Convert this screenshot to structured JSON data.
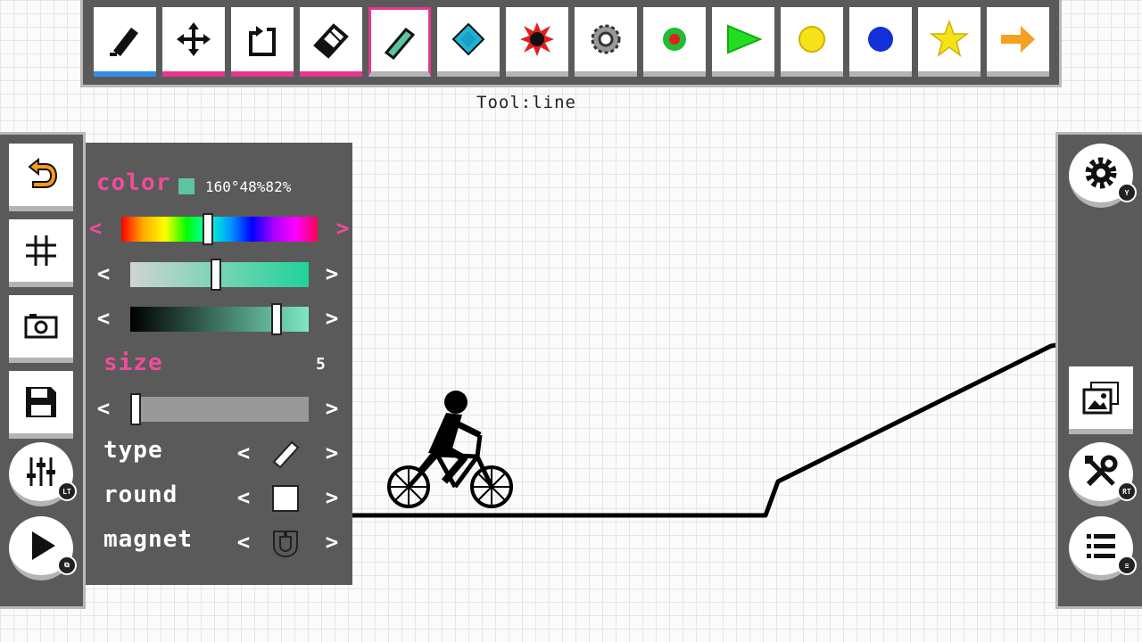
{
  "toolbar": {
    "tools": [
      {
        "id": "pen",
        "icon": "pen-icon"
      },
      {
        "id": "move",
        "icon": "move-arrows-icon"
      },
      {
        "id": "rotate",
        "icon": "rotate-icon"
      },
      {
        "id": "eraser",
        "icon": "eraser-icon"
      },
      {
        "id": "line",
        "icon": "line-icon"
      },
      {
        "id": "diamond",
        "icon": "diamond-icon",
        "color": "#1fb3d6"
      },
      {
        "id": "bomb",
        "icon": "bomb-icon",
        "color": "#e02020"
      },
      {
        "id": "gear",
        "icon": "saw-gear-icon",
        "color": "#888888"
      },
      {
        "id": "green-dot",
        "icon": "checkpoint-icon",
        "color": "#22bb33"
      },
      {
        "id": "boost",
        "icon": "boost-arrow-icon",
        "color": "#22dd22"
      },
      {
        "id": "yellow-dot",
        "icon": "yellow-circle-icon",
        "color": "#f7e21a"
      },
      {
        "id": "blue-dot",
        "icon": "blue-circle-icon",
        "color": "#1030d8"
      },
      {
        "id": "star",
        "icon": "star-icon",
        "color": "#f7e21a"
      },
      {
        "id": "arrow",
        "icon": "orange-arrow-icon",
        "color": "#f5a020"
      }
    ],
    "tool_label": "Tool:line"
  },
  "left_strip": {
    "buttons": [
      "undo-icon",
      "grid-icon",
      "camera-icon",
      "save-icon",
      "sliders-icon",
      "play-icon"
    ],
    "badges": {
      "sliders": "LT",
      "play": "⧉"
    }
  },
  "panel": {
    "color_label": "color",
    "color_value": "160°48%82%",
    "swatch_color": "#5ec3a0",
    "hue_fraction": 0.44,
    "saturation_fraction": 0.48,
    "brightness_fraction": 0.82,
    "size_label": "size",
    "size_value": "5",
    "size_fraction": 0.0,
    "type_label": "type",
    "round_label": "round",
    "magnet_label": "magnet",
    "arrow_left": "<",
    "arrow_right": ">"
  },
  "right_strip": {
    "buttons": [
      "settings-gear-icon",
      "gallery-icon",
      "tools-icon",
      "menu-list-icon"
    ],
    "badges": {
      "settings": "Y",
      "tools": "RT",
      "menu": "≡"
    }
  }
}
